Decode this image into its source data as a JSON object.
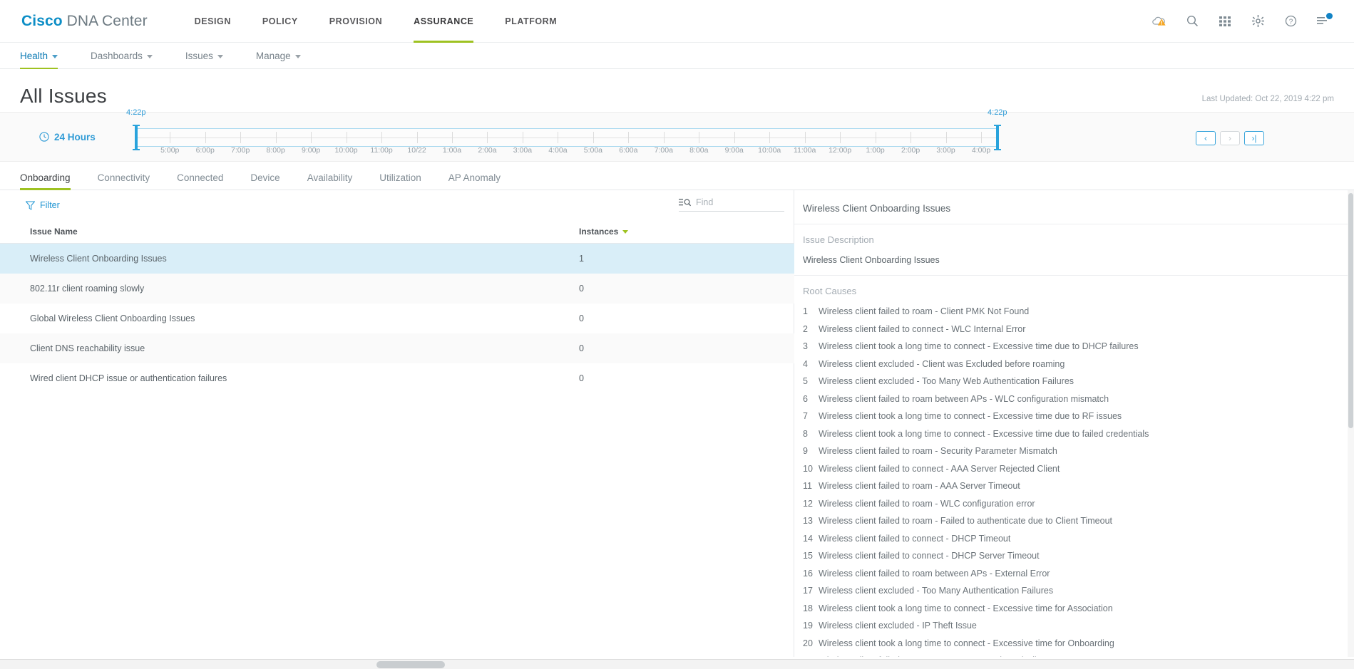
{
  "brand": {
    "bold": "Cisco",
    "light": "DNA Center"
  },
  "topnav": [
    {
      "label": "DESIGN",
      "active": false
    },
    {
      "label": "POLICY",
      "active": false
    },
    {
      "label": "PROVISION",
      "active": false
    },
    {
      "label": "ASSURANCE",
      "active": true
    },
    {
      "label": "PLATFORM",
      "active": false
    }
  ],
  "top_icons": [
    {
      "name": "cloud-warning-icon"
    },
    {
      "name": "search-icon"
    },
    {
      "name": "grid-apps-icon"
    },
    {
      "name": "gear-icon"
    },
    {
      "name": "help-icon"
    },
    {
      "name": "notifications-icon"
    }
  ],
  "subnav": [
    {
      "label": "Health",
      "active": true
    },
    {
      "label": "Dashboards",
      "active": false
    },
    {
      "label": "Issues",
      "active": false
    },
    {
      "label": "Manage",
      "active": false
    }
  ],
  "page": {
    "title": "All Issues",
    "last_updated": "Last Updated: Oct 22, 2019 4:22 pm"
  },
  "timeline": {
    "range_label": "24 Hours",
    "start_time": "4:22p",
    "end_time": "4:22p",
    "ticks": [
      "5:00p",
      "6:00p",
      "7:00p",
      "8:00p",
      "9:00p",
      "10:00p",
      "11:00p",
      "10/22",
      "1:00a",
      "2:00a",
      "3:00a",
      "4:00a",
      "5:00a",
      "6:00a",
      "7:00a",
      "8:00a",
      "9:00a",
      "10:00a",
      "11:00a",
      "12:00p",
      "1:00p",
      "2:00p",
      "3:00p",
      "4:00p"
    ],
    "nav": [
      {
        "name": "prev-button",
        "glyph": "‹",
        "disabled": false
      },
      {
        "name": "next-button",
        "glyph": "›",
        "disabled": true
      },
      {
        "name": "jump-latest-button",
        "glyph": "›|",
        "disabled": false
      }
    ]
  },
  "tabs": [
    {
      "label": "Onboarding",
      "active": true
    },
    {
      "label": "Connectivity",
      "active": false
    },
    {
      "label": "Connected",
      "active": false
    },
    {
      "label": "Device",
      "active": false
    },
    {
      "label": "Availability",
      "active": false
    },
    {
      "label": "Utilization",
      "active": false
    },
    {
      "label": "AP Anomaly",
      "active": false
    }
  ],
  "toolbar": {
    "filter_label": "Filter",
    "find_placeholder": "Find"
  },
  "table": {
    "columns": [
      "Issue Name",
      "Instances"
    ],
    "sort_column": "Instances",
    "sort_direction": "desc",
    "rows": [
      {
        "name": "Wireless Client Onboarding Issues",
        "instances": "1",
        "selected": true
      },
      {
        "name": "802.11r client roaming slowly",
        "instances": "0",
        "selected": false
      },
      {
        "name": "Global Wireless Client Onboarding Issues",
        "instances": "0",
        "selected": false
      },
      {
        "name": "Client DNS reachability issue",
        "instances": "0",
        "selected": false
      },
      {
        "name": "Wired client DHCP issue or authentication failures",
        "instances": "0",
        "selected": false
      }
    ]
  },
  "detail": {
    "title": "Wireless Client Onboarding Issues",
    "description_heading": "Issue Description",
    "description": "Wireless Client Onboarding Issues",
    "root_causes_heading": "Root Causes",
    "root_causes": [
      "Wireless client failed to roam - Client PMK Not Found",
      "Wireless client failed to connect - WLC Internal Error",
      "Wireless client took a long time to connect - Excessive time due to DHCP failures",
      "Wireless client excluded - Client was Excluded before roaming",
      "Wireless client excluded - Too Many Web Authentication Failures",
      "Wireless client failed to roam between APs - WLC configuration mismatch",
      "Wireless client took a long time to connect - Excessive time due to RF issues",
      "Wireless client took a long time to connect - Excessive time due to failed credentials",
      "Wireless client failed to roam - Security Parameter Mismatch",
      "Wireless client failed to connect - AAA Server Rejected Client",
      "Wireless client failed to roam - AAA Server Timeout",
      "Wireless client failed to roam - WLC configuration error",
      "Wireless client failed to roam - Failed to authenticate due to Client Timeout",
      "Wireless client failed to connect - DHCP Timeout",
      "Wireless client failed to connect - DHCP Server Timeout",
      "Wireless client failed to roam between APs - External Error",
      "Wireless client excluded - Too Many Authentication Failures",
      "Wireless client took a long time to connect - Excessive time for Association",
      "Wireless client excluded - IP Theft Issue",
      "Wireless client took a long time to connect - Excessive time for Onboarding",
      "Wireless client failed to roam - AAA Server Rejected Client"
    ]
  },
  "colors": {
    "brand_blue": "#0d8ec6",
    "accent_green": "#9ec221",
    "link_blue": "#1e94d2",
    "selected_row": "#d9eef8",
    "warning_orange": "#f5a623"
  }
}
